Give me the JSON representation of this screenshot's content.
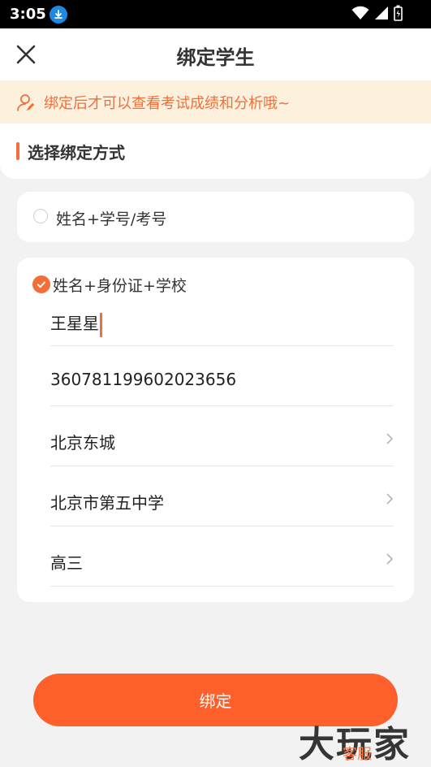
{
  "status_bar": {
    "time": "3:05"
  },
  "header": {
    "title": "绑定学生"
  },
  "notice": {
    "text": "绑定后才可以查看考试成绩和分析哦~"
  },
  "section": {
    "title": "选择绑定方式"
  },
  "options": [
    {
      "label": "姓名+学号/考号",
      "selected": false
    },
    {
      "label": "姓名+身份证+学校",
      "selected": true
    }
  ],
  "form": {
    "name": "王星星",
    "id_number": "360781199602023656",
    "region": "北京东城",
    "school": "北京市第五中学",
    "grade": "高三"
  },
  "action": {
    "bind_label": "绑定"
  },
  "watermark": {
    "brand": "大玩家",
    "sub": "客服"
  },
  "colors": {
    "accent": "#f26f3a",
    "button": "#ff5f2a",
    "notice_bg": "#fdf0dc"
  }
}
